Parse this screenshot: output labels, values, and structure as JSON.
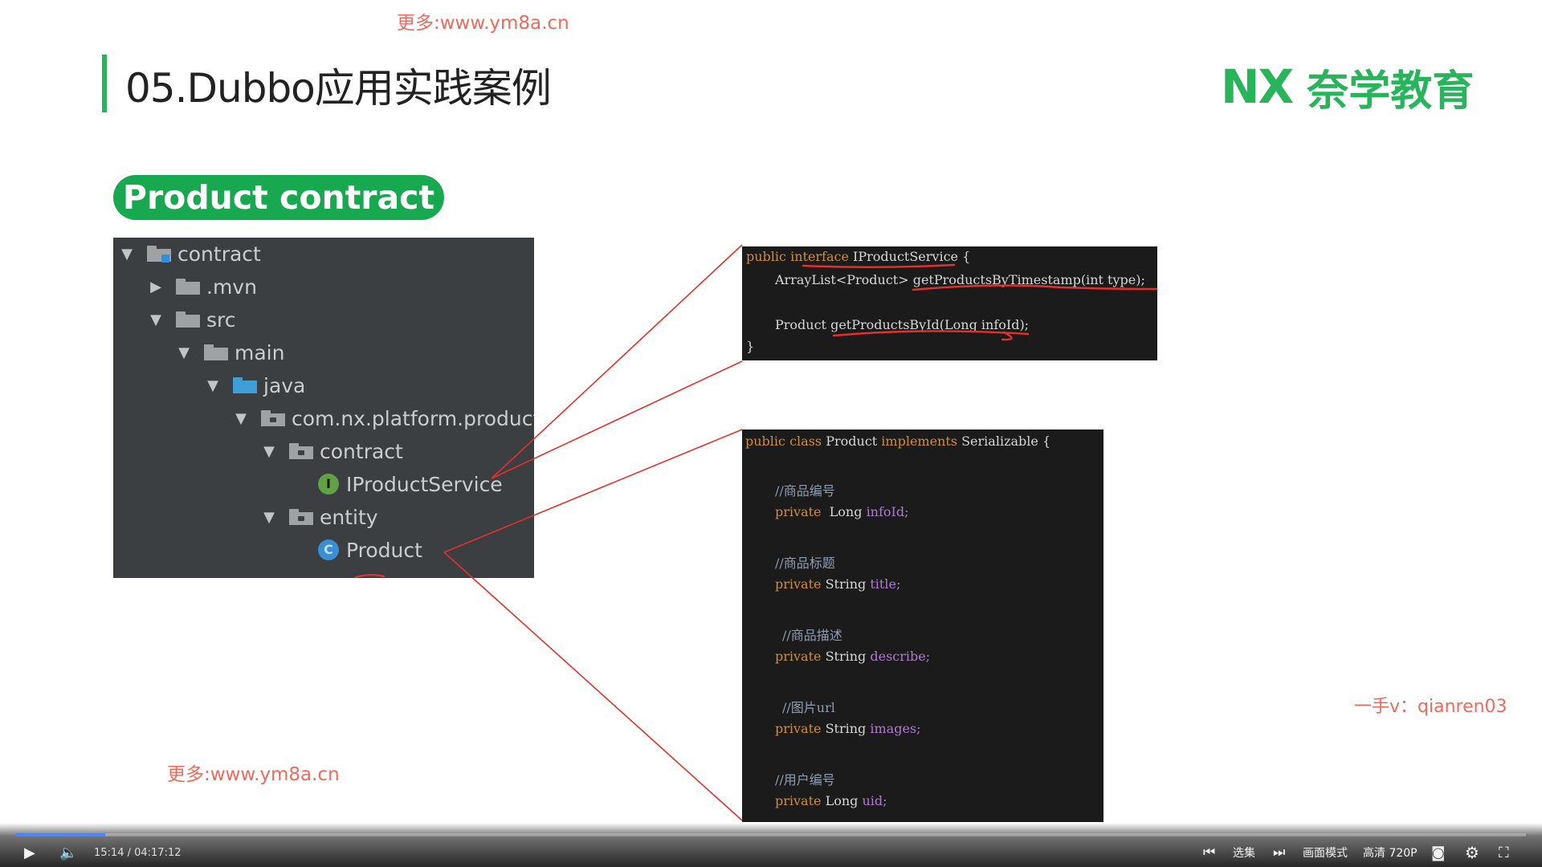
{
  "watermarks": {
    "top": "更多:www.ym8a.cn",
    "bottom": "更多:www.ym8a.cn",
    "right": "一手v：qianren03"
  },
  "slide": {
    "title": "05.Dubbo应用实践案例",
    "brand_mark": "NX",
    "brand_name": "奈学教育",
    "section_label": "Product contract"
  },
  "tree": {
    "items": [
      {
        "label": "contract",
        "icon": "module-folder-icon",
        "expanded": true
      },
      {
        "label": ".mvn",
        "icon": "folder-icon",
        "expanded": false
      },
      {
        "label": "src",
        "icon": "folder-icon",
        "expanded": true
      },
      {
        "label": "main",
        "icon": "folder-icon",
        "expanded": true
      },
      {
        "label": "java",
        "icon": "source-folder-icon",
        "expanded": true
      },
      {
        "label": "com.nx.platform.product",
        "icon": "package-icon",
        "expanded": true
      },
      {
        "label": "contract",
        "icon": "package-icon",
        "expanded": true
      },
      {
        "label": "IProductService",
        "icon": "interface-icon",
        "badge": "I"
      },
      {
        "label": "entity",
        "icon": "package-icon",
        "expanded": true
      },
      {
        "label": "Product",
        "icon": "class-icon",
        "badge": "C"
      }
    ]
  },
  "code_interface": {
    "lines": [
      {
        "kw1": "public",
        "kw2": "interface",
        "rest": "IProductService {"
      },
      {
        "text": "ArrayList<Product> getProductsByTimestamp(int type);"
      },
      {
        "text": "Product getProductsById(Long infoId);"
      },
      {
        "text": "}"
      }
    ]
  },
  "code_class": {
    "header": {
      "kw1": "public",
      "kw2": "class",
      "name": "Product",
      "kw3": "implements",
      "rest": "Serializable {"
    },
    "fields": [
      {
        "comment": "//商品编号",
        "modifier": "private",
        "type": "Long",
        "name": "infoId;"
      },
      {
        "comment": "//商品标题",
        "modifier": "private",
        "type": "String",
        "name": "title;"
      },
      {
        "comment": "//商品描述",
        "modifier": "private",
        "type": "String",
        "name": "describe;"
      },
      {
        "comment": "//图片url",
        "modifier": "private",
        "type": "String",
        "name": "images;"
      },
      {
        "comment": "//用户编号",
        "modifier": "private",
        "type": "Long",
        "name": "uid;"
      }
    ]
  },
  "player": {
    "time": "15:14 / 04:17:12",
    "progress": 0.0589,
    "episodes_label": "选集",
    "mode_label": "画面模式",
    "quality_label": "高清 720P",
    "icons": [
      "play-icon",
      "volume-icon",
      "prev-icon",
      "next-icon",
      "camera-icon",
      "gear-icon",
      "fullscreen-icon"
    ]
  },
  "colors": {
    "brand_green": "#27b45b",
    "watermark": "#ef6a5e",
    "connector": "#e5302b",
    "tree_bg": "#3b3f41",
    "code_bg": "#1b1b1b"
  }
}
